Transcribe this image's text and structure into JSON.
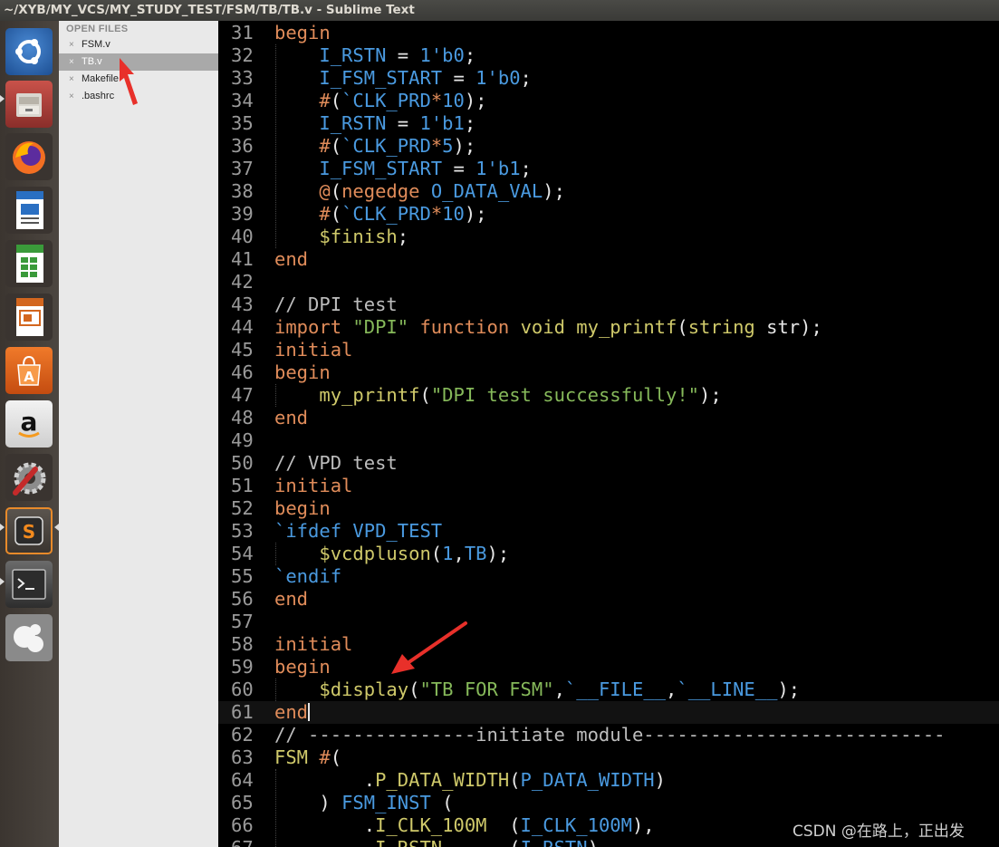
{
  "window": {
    "title": "~/XYB/MY_VCS/MY_STUDY_TEST/FSM/TB/TB.v - Sublime Text"
  },
  "launcher": {
    "items": [
      {
        "name": "ubuntu-dash-icon"
      },
      {
        "name": "files-icon"
      },
      {
        "name": "firefox-icon"
      },
      {
        "name": "writer-icon"
      },
      {
        "name": "calc-icon"
      },
      {
        "name": "impress-icon"
      },
      {
        "name": "software-center-icon"
      },
      {
        "name": "amazon-icon"
      },
      {
        "name": "system-settings-icon"
      },
      {
        "name": "sublime-text-icon"
      },
      {
        "name": "terminal-icon"
      },
      {
        "name": "app-icon"
      }
    ],
    "amazon_glyph": "a",
    "store_glyph": "A",
    "sublime_glyph": "S"
  },
  "sidebar": {
    "header": "OPEN FILES",
    "close_glyph": "×",
    "files": [
      {
        "label": "FSM.v",
        "selected": false
      },
      {
        "label": "TB.v",
        "selected": true
      },
      {
        "label": "Makefile",
        "selected": false
      },
      {
        "label": ".bashrc",
        "selected": false
      }
    ]
  },
  "editor": {
    "lines": [
      {
        "n": "31",
        "t": [
          [
            "kw",
            "begin"
          ]
        ]
      },
      {
        "n": "32",
        "t": [
          [
            "op",
            "    "
          ],
          [
            "id",
            "I_RSTN"
          ],
          [
            "op",
            " = "
          ],
          [
            "num",
            "1'b0"
          ],
          [
            "op",
            ";"
          ]
        ]
      },
      {
        "n": "33",
        "t": [
          [
            "op",
            "    "
          ],
          [
            "id",
            "I_FSM_START"
          ],
          [
            "op",
            " = "
          ],
          [
            "num",
            "1'b0"
          ],
          [
            "op",
            ";"
          ]
        ]
      },
      {
        "n": "34",
        "t": [
          [
            "op",
            "    "
          ],
          [
            "kw",
            "#"
          ],
          [
            "op",
            "("
          ],
          [
            "id",
            "`CLK_PRD"
          ],
          [
            "kw",
            "*"
          ],
          [
            "num",
            "10"
          ],
          [
            "op",
            ");"
          ]
        ]
      },
      {
        "n": "35",
        "t": [
          [
            "op",
            "    "
          ],
          [
            "id",
            "I_RSTN"
          ],
          [
            "op",
            " = "
          ],
          [
            "num",
            "1'b1"
          ],
          [
            "op",
            ";"
          ]
        ]
      },
      {
        "n": "36",
        "t": [
          [
            "op",
            "    "
          ],
          [
            "kw",
            "#"
          ],
          [
            "op",
            "("
          ],
          [
            "id",
            "`CLK_PRD"
          ],
          [
            "kw",
            "*"
          ],
          [
            "num",
            "5"
          ],
          [
            "op",
            ");"
          ]
        ]
      },
      {
        "n": "37",
        "t": [
          [
            "op",
            "    "
          ],
          [
            "id",
            "I_FSM_START"
          ],
          [
            "op",
            " = "
          ],
          [
            "num",
            "1'b1"
          ],
          [
            "op",
            ";"
          ]
        ]
      },
      {
        "n": "38",
        "t": [
          [
            "op",
            "    "
          ],
          [
            "kw",
            "@"
          ],
          [
            "op",
            "("
          ],
          [
            "kw",
            "negedge"
          ],
          [
            "op",
            " "
          ],
          [
            "id",
            "O_DATA_VAL"
          ],
          [
            "op",
            ");"
          ]
        ]
      },
      {
        "n": "39",
        "t": [
          [
            "op",
            "    "
          ],
          [
            "kw",
            "#"
          ],
          [
            "op",
            "("
          ],
          [
            "id",
            "`CLK_PRD"
          ],
          [
            "kw",
            "*"
          ],
          [
            "num",
            "10"
          ],
          [
            "op",
            ");"
          ]
        ]
      },
      {
        "n": "40",
        "t": [
          [
            "op",
            "    "
          ],
          [
            "fn",
            "$finish"
          ],
          [
            "op",
            ";"
          ]
        ]
      },
      {
        "n": "41",
        "t": [
          [
            "kw",
            "end"
          ]
        ]
      },
      {
        "n": "42",
        "t": []
      },
      {
        "n": "43",
        "t": [
          [
            "cm",
            "// DPI test"
          ]
        ]
      },
      {
        "n": "44",
        "t": [
          [
            "kw",
            "import"
          ],
          [
            "op",
            " "
          ],
          [
            "str",
            "\"DPI\""
          ],
          [
            "op",
            " "
          ],
          [
            "kw",
            "function"
          ],
          [
            "op",
            " "
          ],
          [
            "fn",
            "void"
          ],
          [
            "op",
            " "
          ],
          [
            "fn",
            "my_printf"
          ],
          [
            "op",
            "("
          ],
          [
            "fn",
            "string"
          ],
          [
            "op",
            " str);"
          ]
        ]
      },
      {
        "n": "45",
        "t": [
          [
            "kw",
            "initial"
          ]
        ]
      },
      {
        "n": "46",
        "t": [
          [
            "kw",
            "begin"
          ]
        ]
      },
      {
        "n": "47",
        "t": [
          [
            "op",
            "    "
          ],
          [
            "fn",
            "my_printf"
          ],
          [
            "op",
            "("
          ],
          [
            "str",
            "\"DPI test successfully!\""
          ],
          [
            "op",
            ");"
          ]
        ]
      },
      {
        "n": "48",
        "t": [
          [
            "kw",
            "end"
          ]
        ]
      },
      {
        "n": "49",
        "t": []
      },
      {
        "n": "50",
        "t": [
          [
            "cm",
            "// VPD test"
          ]
        ]
      },
      {
        "n": "51",
        "t": [
          [
            "kw",
            "initial"
          ]
        ]
      },
      {
        "n": "52",
        "t": [
          [
            "kw",
            "begin"
          ]
        ]
      },
      {
        "n": "53",
        "t": [
          [
            "id",
            "`ifdef"
          ],
          [
            "op",
            " "
          ],
          [
            "id",
            "VPD_TEST"
          ]
        ]
      },
      {
        "n": "54",
        "t": [
          [
            "op",
            "    "
          ],
          [
            "fn",
            "$vcdpluson"
          ],
          [
            "op",
            "("
          ],
          [
            "num",
            "1"
          ],
          [
            "op",
            ","
          ],
          [
            "id",
            "TB"
          ],
          [
            "op",
            ");"
          ]
        ]
      },
      {
        "n": "55",
        "t": [
          [
            "id",
            "`endif"
          ]
        ]
      },
      {
        "n": "56",
        "t": [
          [
            "kw",
            "end"
          ]
        ]
      },
      {
        "n": "57",
        "t": []
      },
      {
        "n": "58",
        "t": [
          [
            "kw",
            "initial"
          ]
        ]
      },
      {
        "n": "59",
        "t": [
          [
            "kw",
            "begin"
          ]
        ]
      },
      {
        "n": "60",
        "t": [
          [
            "op",
            "    "
          ],
          [
            "fn",
            "$display"
          ],
          [
            "op",
            "("
          ],
          [
            "str",
            "\"TB FOR FSM\""
          ],
          [
            "op",
            ","
          ],
          [
            "id",
            "`__FILE__"
          ],
          [
            "op",
            ","
          ],
          [
            "id",
            "`__LINE__"
          ],
          [
            "op",
            ");"
          ]
        ]
      },
      {
        "n": "61",
        "t": [
          [
            "kw",
            "end"
          ]
        ],
        "cursor": true
      },
      {
        "n": "62",
        "t": [
          [
            "cm",
            "// ---------------initiate module---------------------------"
          ]
        ]
      },
      {
        "n": "63",
        "t": [
          [
            "fn",
            "FSM"
          ],
          [
            "op",
            " "
          ],
          [
            "kw",
            "#"
          ],
          [
            "op",
            "("
          ]
        ]
      },
      {
        "n": "64",
        "t": [
          [
            "op",
            "        ."
          ],
          [
            "fn",
            "P_DATA_WIDTH"
          ],
          [
            "op",
            "("
          ],
          [
            "id",
            "P_DATA_WIDTH"
          ],
          [
            "op",
            ")"
          ]
        ]
      },
      {
        "n": "65",
        "t": [
          [
            "op",
            "    ) "
          ],
          [
            "id",
            "FSM_INST"
          ],
          [
            "op",
            " ("
          ]
        ]
      },
      {
        "n": "66",
        "t": [
          [
            "op",
            "        ."
          ],
          [
            "fn",
            "I_CLK_100M"
          ],
          [
            "op",
            "  ("
          ],
          [
            "id",
            "I_CLK_100M"
          ],
          [
            "op",
            "),"
          ]
        ]
      },
      {
        "n": "67",
        "t": [
          [
            "op",
            "        ."
          ],
          [
            "fn",
            "I_RSTN"
          ],
          [
            "op",
            "      ("
          ],
          [
            "id",
            "I_RSTN"
          ],
          [
            "op",
            "),"
          ]
        ]
      }
    ]
  },
  "watermark": "CSDN @在路上，正出发",
  "colors": {
    "annotation_arrow": "#e8302a",
    "keyword": "#e08c5a",
    "identifier": "#4a9ae0",
    "function": "#cfc96a",
    "string": "#86b95a"
  }
}
